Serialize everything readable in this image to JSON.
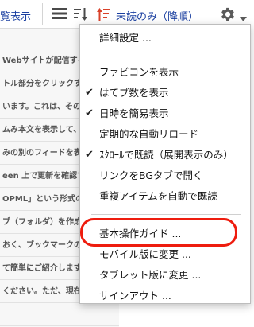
{
  "toolbar": {
    "view_label": "覧表示",
    "unread_label": "未読のみ（降順）"
  },
  "article_list": [
    "Webサイトが配信する",
    "トル部分をクリックす",
    "います。これは、その",
    "ムみ本文を表示して、",
    "みの別のフィードを表",
    "een 上で更新を確認で",
    "OPML」という形式の",
    "ブ（フォルダ）を作成",
    "おく、ブックマークの",
    "て簡単にご紹介します",
    "ください。ただ、現在の"
  ],
  "menu": {
    "detail_settings": "詳細設定 ...",
    "items": [
      {
        "label": "ファビコンを表示",
        "checked": false
      },
      {
        "label": "はてブ数を表示",
        "checked": true
      },
      {
        "label": "日時を簡易表示",
        "checked": true
      },
      {
        "label": "定期的な自動リロード",
        "checked": false
      },
      {
        "label": "ｽｸﾛｰﾙで既読（展開表示のみ）",
        "checked": true
      },
      {
        "label": "リンクをBGタブで開く",
        "checked": false
      },
      {
        "label": "重複アイテムを自動で既読",
        "checked": false
      }
    ],
    "guide": "基本操作ガイド ...",
    "mobile": "モバイル版に変更 ...",
    "tablet": "タブレット版に変更 ...",
    "signout": "サインアウト ..."
  },
  "colors": {
    "accent_blue": "#1a3fa0",
    "highlight_red": "#ee1c0e",
    "sort_icon_red": "#d9412a"
  }
}
